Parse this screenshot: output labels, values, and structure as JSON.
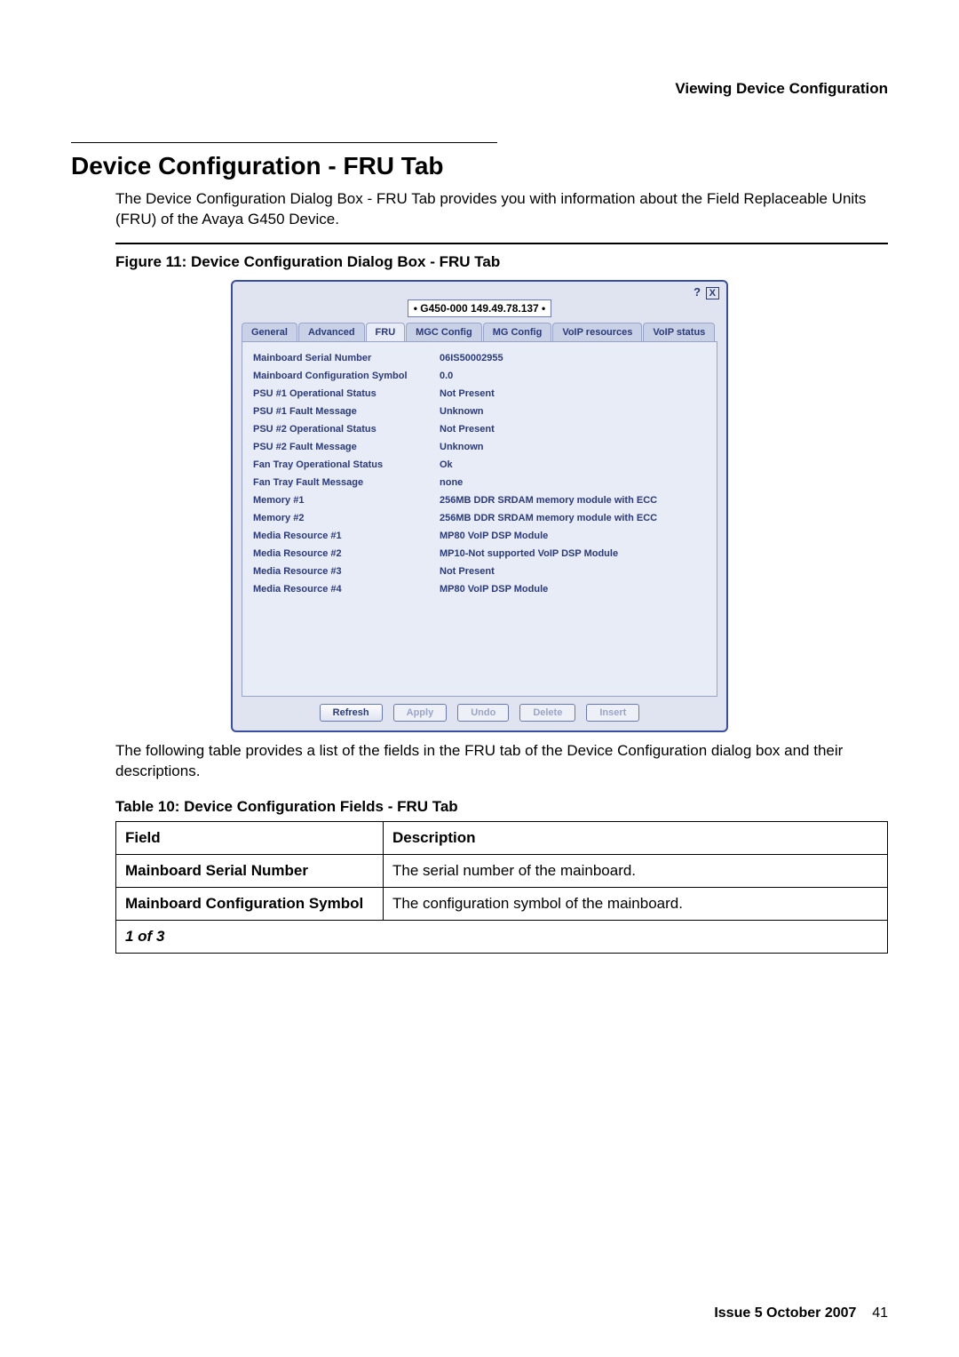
{
  "header": {
    "running_head": "Viewing Device Configuration"
  },
  "section": {
    "title": "Device Configuration - FRU Tab",
    "intro": "The Device Configuration Dialog Box - FRU Tab provides you with information about the Field Replaceable Units (FRU) of the Avaya G450 Device.",
    "figure_caption": "Figure 11: Device Configuration Dialog Box - FRU Tab",
    "after_figure": "The following table provides a list of the fields in the FRU tab of the Device Configuration dialog box and their descriptions.",
    "table_caption": "Table 10: Device Configuration Fields - FRU Tab"
  },
  "dialog": {
    "title": "• G450-000 149.49.78.137 •",
    "tabs": [
      "General",
      "Advanced",
      "FRU",
      "MGC Config",
      "MG Config",
      "VoIP resources",
      "VoIP status"
    ],
    "active_tab_index": 2,
    "rows": [
      {
        "label": "Mainboard Serial Number",
        "value": "06IS50002955"
      },
      {
        "label": "Mainboard Configuration Symbol",
        "value": "0.0"
      },
      {
        "label": "PSU #1 Operational Status",
        "value": "Not Present"
      },
      {
        "label": "PSU #1 Fault Message",
        "value": "Unknown"
      },
      {
        "label": "PSU #2 Operational Status",
        "value": "Not Present"
      },
      {
        "label": "PSU #2 Fault Message",
        "value": "Unknown"
      },
      {
        "label": "Fan Tray Operational Status",
        "value": "Ok"
      },
      {
        "label": "Fan Tray Fault Message",
        "value": "none"
      },
      {
        "label": "Memory #1",
        "value": "256MB DDR SRDAM memory module with ECC"
      },
      {
        "label": "Memory #2",
        "value": "256MB DDR SRDAM memory module with ECC"
      },
      {
        "label": "Media Resource #1",
        "value": "MP80 VoIP DSP Module"
      },
      {
        "label": "Media Resource #2",
        "value": "MP10-Not supported VoIP DSP Module"
      },
      {
        "label": "Media Resource #3",
        "value": "Not Present"
      },
      {
        "label": "Media Resource #4",
        "value": "MP80 VoIP DSP Module"
      }
    ],
    "buttons": {
      "refresh": "Refresh",
      "apply": "Apply",
      "undo": "Undo",
      "delete": "Delete",
      "insert": "Insert"
    }
  },
  "table": {
    "head_field": "Field",
    "head_desc": "Description",
    "rows": [
      {
        "field": "Mainboard Serial Number",
        "desc": "The serial number of the mainboard."
      },
      {
        "field": "Mainboard Configuration Symbol",
        "desc": "The configuration symbol of the mainboard."
      }
    ],
    "pager": "1 of 3"
  },
  "footer": {
    "issue": "Issue 5   October 2007",
    "page": "41"
  }
}
